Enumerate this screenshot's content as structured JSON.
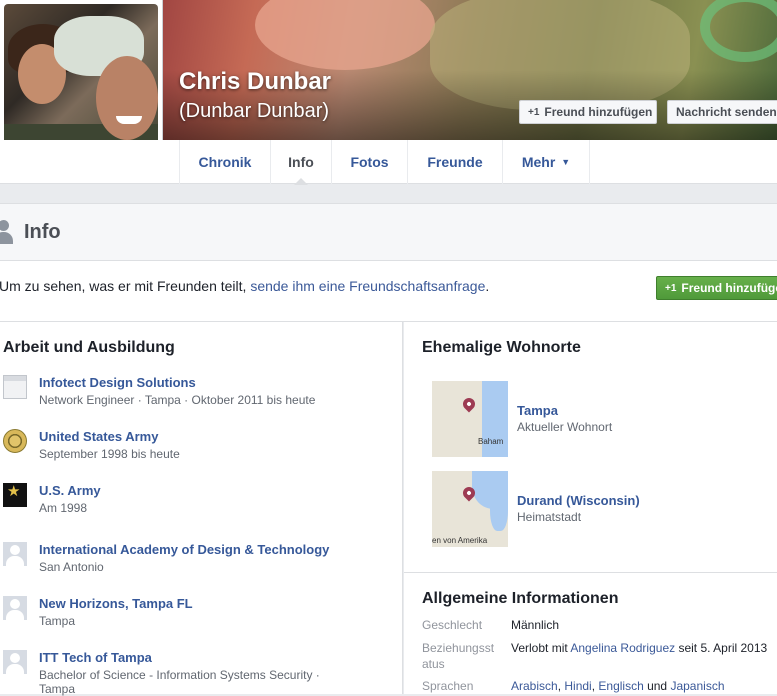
{
  "profile": {
    "name": "Chris Dunbar",
    "alt_name": "(Dunbar Dunbar)",
    "add_friend_label": "Freund hinzufügen",
    "message_label": "Nachricht senden"
  },
  "tabs": [
    {
      "label": "Chronik"
    },
    {
      "label": "Info"
    },
    {
      "label": "Fotos"
    },
    {
      "label": "Freunde"
    },
    {
      "label": "Mehr"
    }
  ],
  "info_header": {
    "title": "Info"
  },
  "friend_request": {
    "text": "Um zu sehen, was er mit Freunden teilt, ",
    "link": "sende ihm eine Freundschaftsanfrage",
    "period": ".",
    "button": "Freund hinzufügen"
  },
  "work": {
    "title": "Arbeit und Ausbildung",
    "items": [
      {
        "name": "Infotect Design Solutions",
        "sub": "Network Engineer · Tampa · Oktober 2011 bis heute",
        "icon": "company-page-icon"
      },
      {
        "name": "United States Army",
        "sub": "September 1998 bis heute",
        "icon": "army-seal-icon"
      },
      {
        "name": "U.S. Army",
        "sub": "Am 1998",
        "icon": "army-star-icon"
      },
      {
        "name": "International Academy of Design & Technology",
        "sub": "San Antonio",
        "icon": "school-person-icon"
      },
      {
        "name": "New Horizons, Tampa FL",
        "sub": "Tampa",
        "icon": "school-person-icon"
      },
      {
        "name": "ITT Tech of Tampa",
        "sub": "Bachelor of Science - Information Systems Security ·",
        "sub2": "Tampa",
        "icon": "school-person-icon"
      }
    ]
  },
  "places": {
    "title": "Ehemalige Wohnorte",
    "items": [
      {
        "name": "Tampa",
        "sub": "Aktueller Wohnort",
        "map_label": "Baham"
      },
      {
        "name": "Durand (Wisconsin)",
        "sub": "Heimatstadt",
        "map_label": "en von Amerika"
      }
    ]
  },
  "general": {
    "title": "Allgemeine Informationen",
    "gender_label": "Geschlecht",
    "gender_value": "Männlich",
    "relationship_label_1": "Beziehungsst",
    "relationship_label_2": "atus",
    "relationship_prefix": "Verlobt mit ",
    "relationship_partner": "Angelina Rodriguez",
    "relationship_suffix": " seit 5. April 2013",
    "languages_label": "Sprachen",
    "languages": [
      "Arabisch",
      "Hindi",
      "Englisch",
      "Japanisch"
    ],
    "lang_sep_1": ", ",
    "lang_sep_2": ", ",
    "lang_sep_3": " und "
  },
  "colors": {
    "link": "#365899",
    "green": "#5cb85c",
    "muted": "#616770"
  }
}
